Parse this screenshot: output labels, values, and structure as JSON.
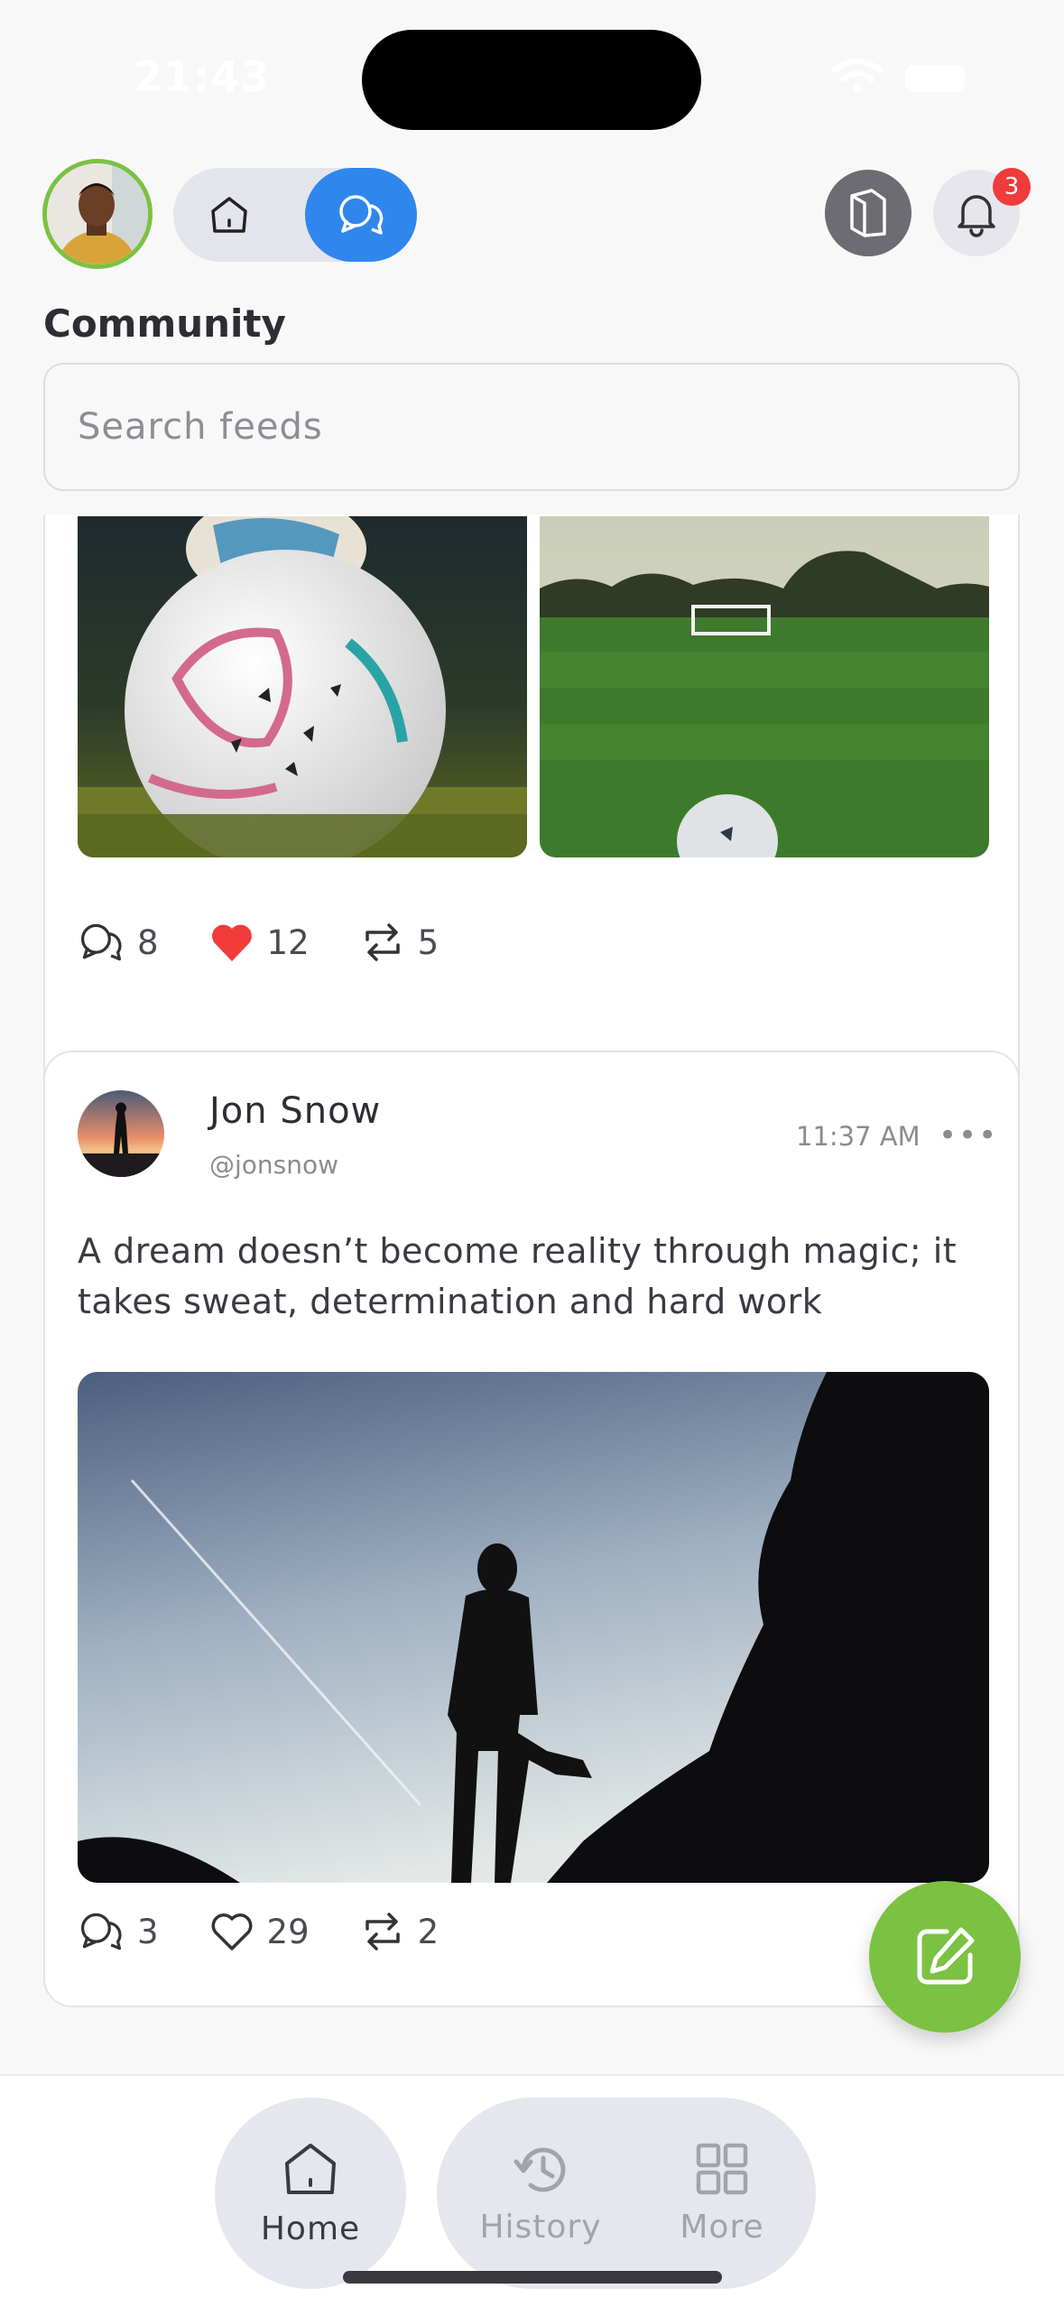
{
  "status_bar": {
    "time": "21:43"
  },
  "header": {
    "title": "Community",
    "notification_count": "3",
    "search_placeholder": "Search feeds"
  },
  "posts": [
    {
      "stats": {
        "comments": "8",
        "likes": "12",
        "reposts": "5"
      },
      "liked": true
    },
    {
      "author": "Jon Snow",
      "handle": "@jonsnow",
      "time": "11:37 AM",
      "more": "•••",
      "text": "A dream doesn’t become reality through magic; it takes sweat, determination and hard work",
      "stats": {
        "comments": "3",
        "likes": "29",
        "reposts": "2"
      },
      "liked": false
    }
  ],
  "tabbar": {
    "home": "Home",
    "history": "History",
    "more": "More"
  },
  "colors": {
    "accent_blue": "#2f87ee",
    "accent_green": "#7bc142",
    "badge_red": "#ef3b3b",
    "like_red": "#f23b3b"
  },
  "icons": [
    "home-icon",
    "community-icon",
    "book-icon",
    "bell-icon",
    "comment-icon",
    "heart-icon",
    "repost-icon",
    "edit-icon",
    "history-icon",
    "grid-icon"
  ]
}
